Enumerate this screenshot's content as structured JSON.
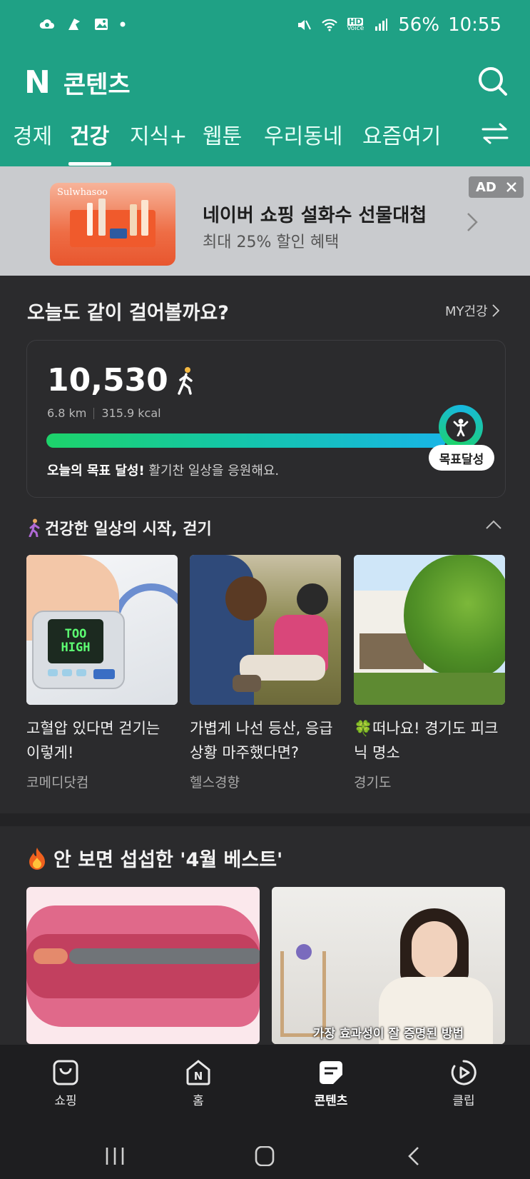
{
  "status_bar": {
    "battery": "56%",
    "time": "10:55",
    "hd_label": "HD",
    "voice_label": "Voice"
  },
  "header": {
    "logo": "N",
    "title": "콘텐츠",
    "tabs": [
      "경제",
      "건강",
      "지식+",
      "웹툰",
      "우리동네",
      "요즘여기"
    ],
    "active_tab": "건강"
  },
  "ad": {
    "brand": "Sulwhasoo",
    "title": "네이버 쇼핑 설화수 선물대첩",
    "subtitle": "최대 25% 할인 혜택",
    "badge": "AD"
  },
  "walk": {
    "title": "오늘도 같이 걸어볼까요?",
    "my_link": "MY건강",
    "steps": "10,530",
    "distance": "6.8 km",
    "calories": "315.9 kcal",
    "progress": 1.0,
    "goal_label": "목표달성",
    "cheer_bold": "오늘의 목표 달성!",
    "cheer_rest": " 활기찬 일상을 응원해요."
  },
  "walking_section": {
    "title": "건강한 일상의 시작, 걷기",
    "cards": [
      {
        "title": "고혈압 있다면 걷기는 이렇게!",
        "source": "코메디닷컴",
        "img_text_1": "TOO",
        "img_text_2": "HIGH"
      },
      {
        "title": "가볍게 나선 등산, 응급상황 마주했다면?",
        "source": "헬스경향"
      },
      {
        "title": "🍀떠나요! 경기도 피크닉 명소",
        "source": "경기도"
      }
    ]
  },
  "best_section": {
    "title": "안 보면 섭섭한 '4월 베스트'",
    "video_caption": "가장 효과성이 잘 증명된 방법"
  },
  "bottom_nav": {
    "items": [
      "쇼핑",
      "홈",
      "콘텐츠",
      "클립"
    ],
    "home_icon_letter": "N",
    "active": "콘텐츠"
  },
  "colors": {
    "brand_green": "#1fa185",
    "background": "#2b2b2d",
    "nav_bg": "#1e1e20"
  }
}
